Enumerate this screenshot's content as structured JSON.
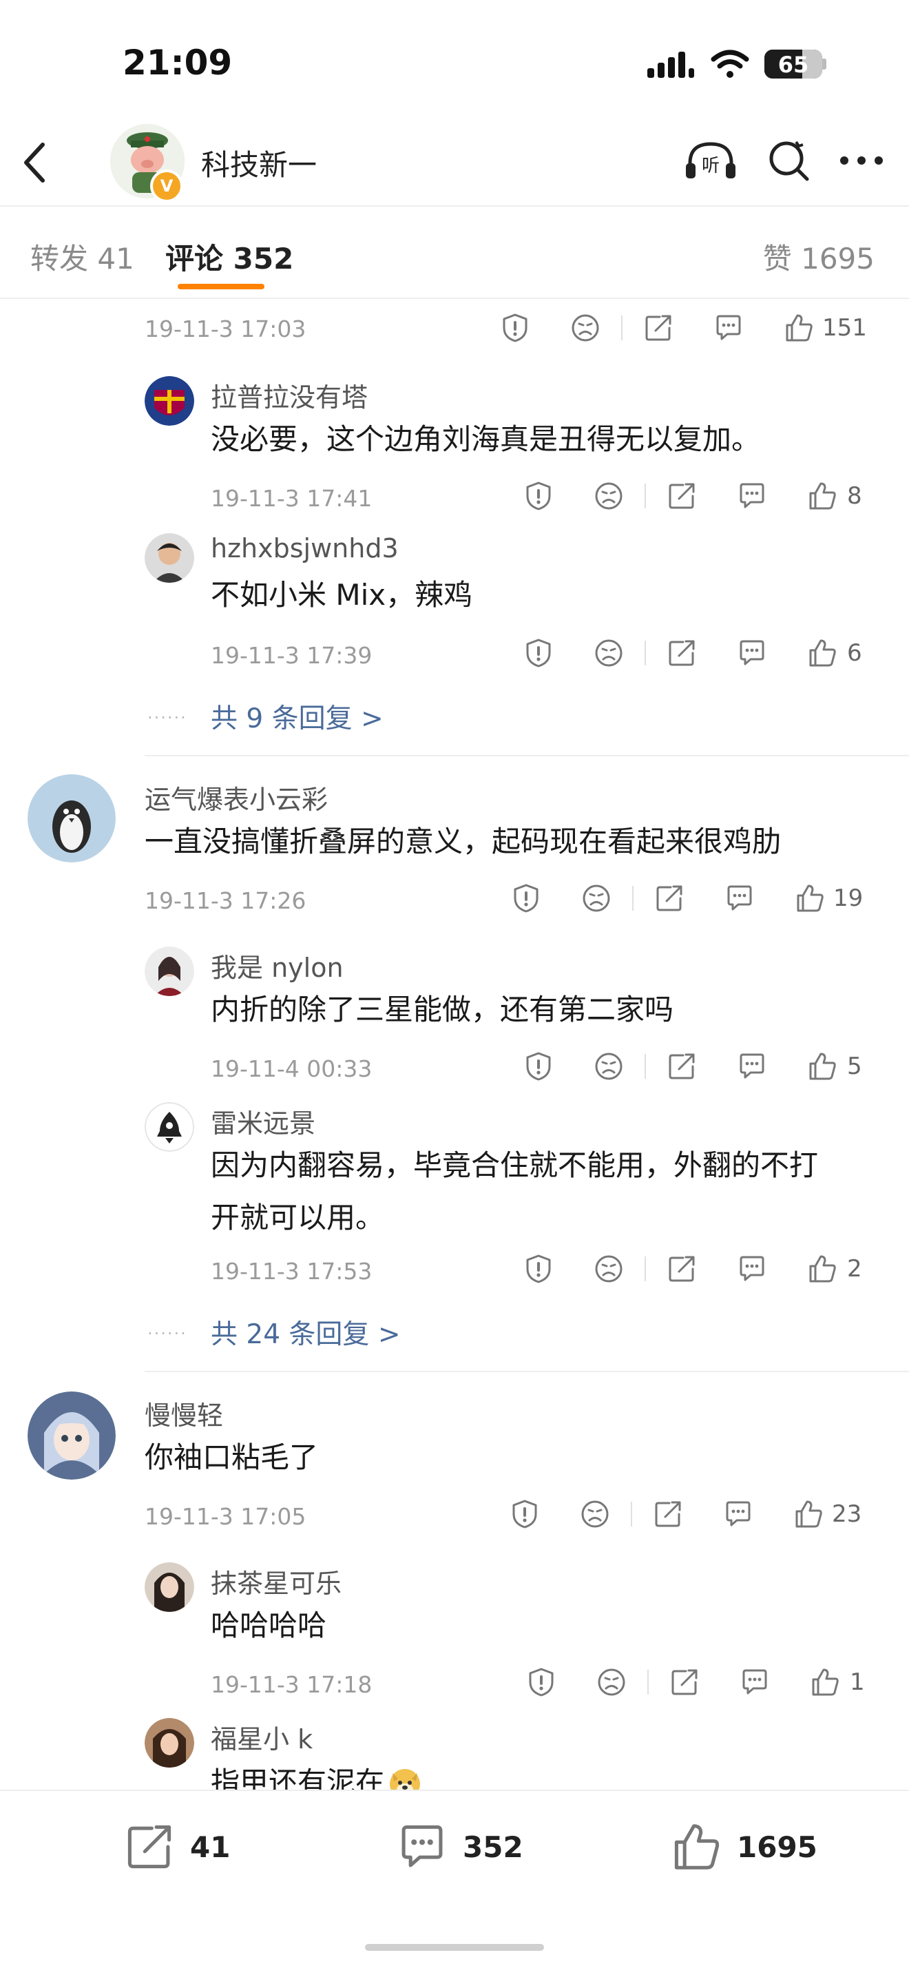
{
  "status_bar": {
    "time": "21:09",
    "battery": "65",
    "battery_level": 0.65
  },
  "header": {
    "title": "科技新一",
    "verified_badge": "V"
  },
  "tabs": {
    "repost": "转发 41",
    "comments": "评论 352",
    "likes": "赞 1695"
  },
  "feed": {
    "top": {
      "time": "19-11-3 17:03",
      "likes": "151"
    },
    "thread1": {
      "replies": [
        {
          "name": "拉普拉没有塔",
          "text": "没必要，这个边角刘海真是丑得无以复加。",
          "time": "19-11-3 17:41",
          "likes": "8"
        },
        {
          "name": "hzhxbsjwnhd3",
          "text": "不如小米 Mix，辣鸡",
          "time": "19-11-3 17:39",
          "likes": "6"
        }
      ],
      "more": "共 9 条回复 >"
    },
    "comment2": {
      "name": "运气爆表小云彩",
      "text": "一直没搞懂折叠屏的意义，起码现在看起来很鸡肋",
      "time": "19-11-3 17:26",
      "likes": "19",
      "replies": [
        {
          "name": "我是 nylon",
          "text": "内折的除了三星能做，还有第二家吗",
          "time": "19-11-4 00:33",
          "likes": "5"
        },
        {
          "name": "雷米远景",
          "text_line1": "因为内翻容易，毕竟合住就不能用，外翻的不打",
          "text_line2": "开就可以用。",
          "time": "19-11-3 17:53",
          "likes": "2"
        }
      ],
      "more": "共 24 条回复 >"
    },
    "comment3": {
      "name": "慢慢轻",
      "text": "你袖口粘毛了",
      "time": "19-11-3 17:05",
      "likes": "23",
      "replies": [
        {
          "name": "抹茶星可乐",
          "text": "哈哈哈哈",
          "time": "19-11-3 17:18",
          "likes": "1"
        },
        {
          "name": "福星小 k",
          "text": "指甲还有泥在"
        }
      ]
    }
  },
  "bottom_bar": {
    "reposts": "41",
    "comments": "352",
    "likes": "1695"
  },
  "colors": {
    "accent": "#ff8200",
    "link": "#4a6b9a",
    "badge": "#f5a623"
  },
  "icons": [
    "back-icon",
    "listen-icon",
    "search-icon",
    "more-icon",
    "report-icon",
    "dislike-icon",
    "share-icon",
    "comment-icon",
    "like-icon"
  ]
}
